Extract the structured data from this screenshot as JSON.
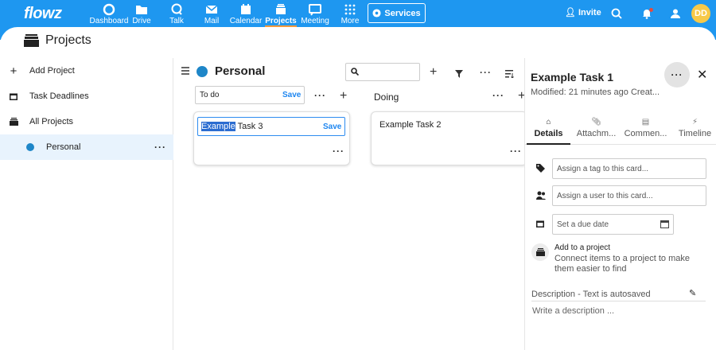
{
  "brand": {
    "logo": "flowz",
    "accent": "#1e97f0",
    "active_tab_color": "#f39a3d"
  },
  "topnav": {
    "items": [
      {
        "label": "Dashboard",
        "icon": "dashboard-icon"
      },
      {
        "label": "Drive",
        "icon": "folder-icon"
      },
      {
        "label": "Talk",
        "icon": "talk-icon"
      },
      {
        "label": "Mail",
        "icon": "mail-icon"
      },
      {
        "label": "Calendar",
        "icon": "calendar-icon"
      },
      {
        "label": "Projects",
        "icon": "projects-icon",
        "active": true
      },
      {
        "label": "Meeting",
        "icon": "meeting-icon"
      },
      {
        "label": "More",
        "icon": "grid-icon"
      }
    ],
    "services_label": "Services",
    "invite_label": "Invite",
    "avatar_initials": "DD"
  },
  "page": {
    "title": "Projects"
  },
  "sidebar": {
    "items": [
      {
        "label": "Add Project",
        "icon": "plus-icon"
      },
      {
        "label": "Task Deadlines",
        "icon": "calendar-icon"
      },
      {
        "label": "All Projects",
        "icon": "stack-icon"
      },
      {
        "label": "Personal",
        "icon": "dot-icon",
        "selected": true
      }
    ]
  },
  "board": {
    "title": "Personal",
    "columns": [
      {
        "name_input": "To do",
        "save_label": "Save",
        "cards": [
          {
            "text_highlight": "Example",
            "text_rest": " Task 3",
            "save_label": "Save"
          }
        ]
      },
      {
        "name": "Doing",
        "cards": [
          {
            "text": "Example Task 2"
          }
        ]
      }
    ]
  },
  "detail": {
    "title": "Example Task 1",
    "modified": "Modified: 21 minutes ago Creat...",
    "tabs": [
      "Details",
      "Attachm...",
      "Commen...",
      "Timeline"
    ],
    "tag_placeholder": "Assign a tag to this card...",
    "user_placeholder": "Assign a user to this card...",
    "due_placeholder": "Set a due date",
    "add_project_title": "Add to a project",
    "add_project_text": "Connect items to a project to make them easier to find",
    "description_label": "Description - Text is autosaved",
    "description_placeholder": "Write a description ..."
  }
}
